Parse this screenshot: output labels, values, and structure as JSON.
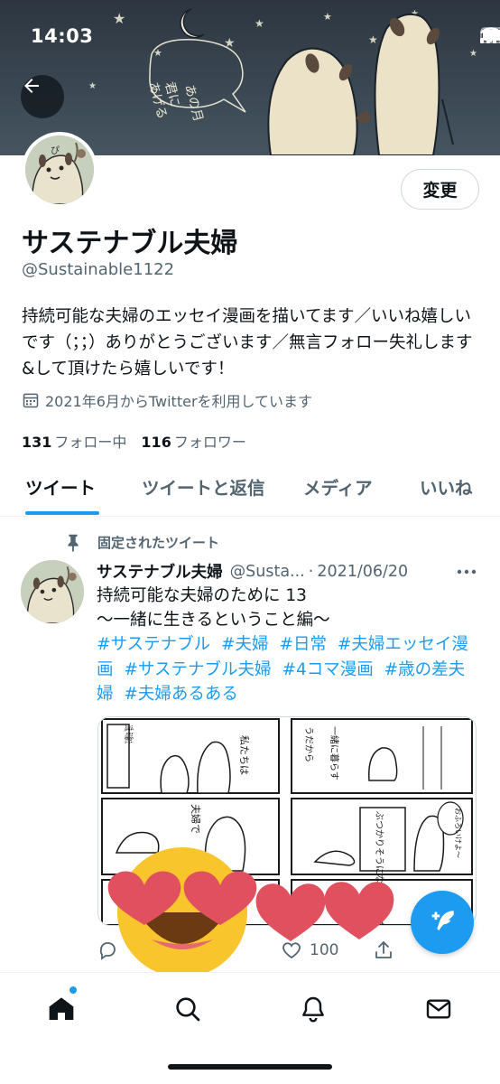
{
  "status_bar": {
    "time": "14:03"
  },
  "banner": {
    "speech_text_line1": "あの月",
    "speech_text_line2": "君に",
    "speech_text_line3": "あげる"
  },
  "profile": {
    "edit_label": "変更",
    "display_name": "サステナブル夫婦",
    "handle": "@Sustainable1122",
    "bio": "持続可能な夫婦のエッセイ漫画を描いてます／いいね嬉しいです（；；）ありがとうございます／無言フォロー失礼します&して頂けたら嬉しいです！",
    "joined": "2021年6月からTwitterを利用しています",
    "following_count": "131",
    "following_label": "フォロー中",
    "followers_count": "116",
    "followers_label": "フォロワー"
  },
  "tabs": [
    {
      "label": "ツイート",
      "active": true
    },
    {
      "label": "ツイートと返信",
      "active": false
    },
    {
      "label": "メディア",
      "active": false
    },
    {
      "label": "いいね",
      "active": false
    }
  ],
  "tweet": {
    "pinned_label": "固定されたツイート",
    "name": "サステナブル夫婦",
    "handle": "@Susta...",
    "separator": "·",
    "date": "2021/06/20",
    "text_line1": "持続可能な夫婦のために 13",
    "text_line2": "〜一緒に生きるということ編〜",
    "hashtags": [
      "#サステナブル",
      "#夫婦",
      "#日常",
      "#夫婦エッセイ漫画",
      "#サステナブル夫婦",
      "#4コマ漫画",
      "#歳の差夫婦",
      "#夫婦あるある"
    ],
    "like_count": "100"
  },
  "comic_text": {
    "p1": "18歳、年の離れた",
    "p2": "私たちは",
    "p3": "夫婦で",
    "p4": "うだから",
    "p5": "一緒に暮らす",
    "p6": "ぶつかりそうになることもある",
    "p7": "おふろいけよ〜"
  },
  "colors": {
    "accent": "#1d9bf0",
    "text": "#0f1419",
    "muted": "#536471",
    "banner": "#2d3640"
  },
  "icons": [
    "back-arrow-icon",
    "calendar-icon",
    "pin-icon",
    "more-icon",
    "reply-icon",
    "like-icon",
    "share-icon",
    "compose-icon",
    "home-icon",
    "search-icon",
    "notifications-icon",
    "messages-icon"
  ]
}
